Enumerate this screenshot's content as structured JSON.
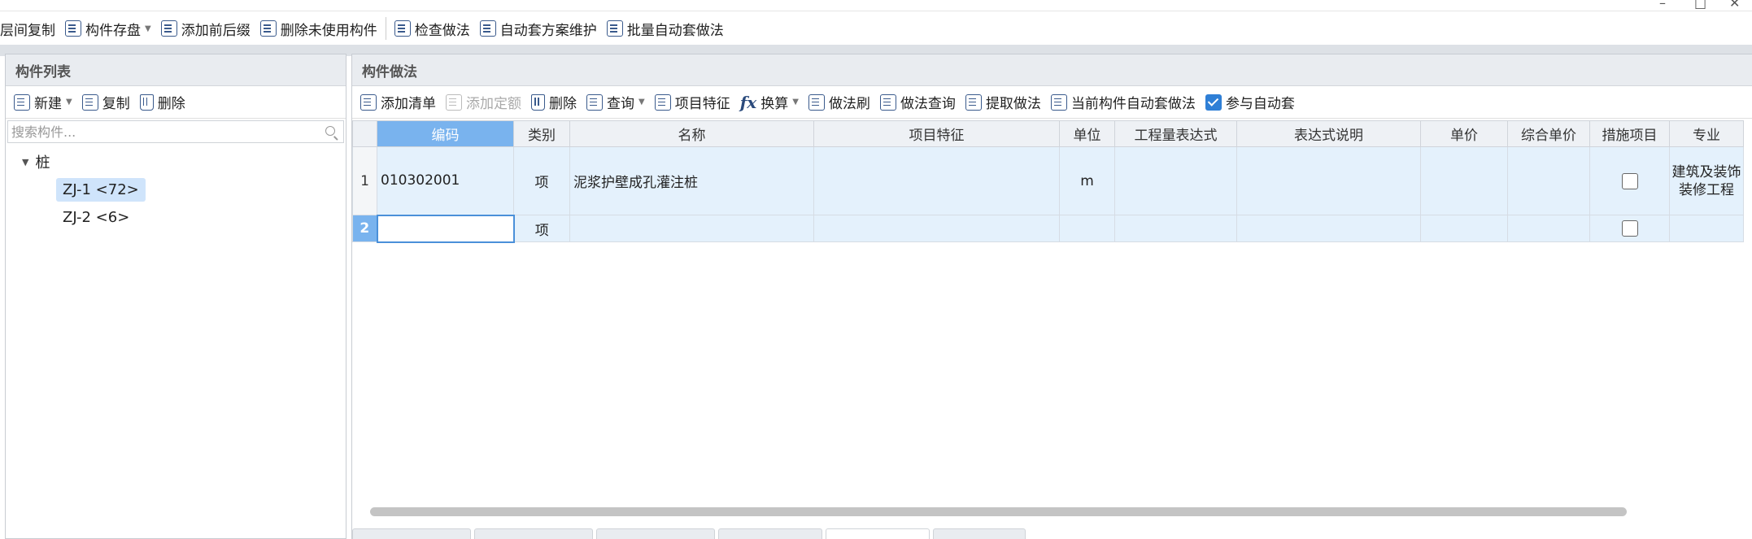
{
  "window": {
    "minimize": "–",
    "maximize": "□",
    "close": "✕"
  },
  "main_toolbar": {
    "items": [
      "层间复制",
      "构件存盘",
      "添加前后缀",
      "删除未使用构件",
      "检查做法",
      "自动套方案维护",
      "批量自动套做法"
    ]
  },
  "left_panel": {
    "title": "构件列表",
    "toolbar": {
      "new": "新建",
      "copy": "复制",
      "delete": "删除"
    },
    "search_placeholder": "搜索构件...",
    "tree": {
      "root": "桩",
      "children": [
        "ZJ-1 <72>",
        "ZJ-2 <6>"
      ],
      "selected": "ZJ-1 <72>"
    }
  },
  "right_panel": {
    "title": "构件做法",
    "toolbar": {
      "add_list": "添加清单",
      "add_quota": "添加定额",
      "delete": "删除",
      "query": "查询",
      "item_feature": "项目特征",
      "convert": "换算",
      "method_brush": "做法刷",
      "method_query": "做法查询",
      "extract_method": "提取做法",
      "current_auto": "当前构件自动套做法",
      "join_auto": "参与自动套"
    },
    "grid": {
      "headers": [
        "",
        "编码",
        "类别",
        "名称",
        "项目特征",
        "单位",
        "工程量表达式",
        "表达式说明",
        "单价",
        "综合单价",
        "措施项目",
        "专业"
      ],
      "rows": [
        {
          "no": "1",
          "code": "010302001",
          "type": "项",
          "name": "泥浆护壁成孔灌注桩",
          "feature": "",
          "unit": "m",
          "expr": "",
          "expr_desc": "",
          "price": "",
          "total_price": "",
          "specialty": "建筑及装饰装修工程"
        },
        {
          "no": "2",
          "code": "",
          "type": "项",
          "name": "",
          "feature": "",
          "unit": "",
          "expr": "",
          "expr_desc": "",
          "price": "",
          "total_price": "",
          "specialty": ""
        }
      ]
    }
  }
}
